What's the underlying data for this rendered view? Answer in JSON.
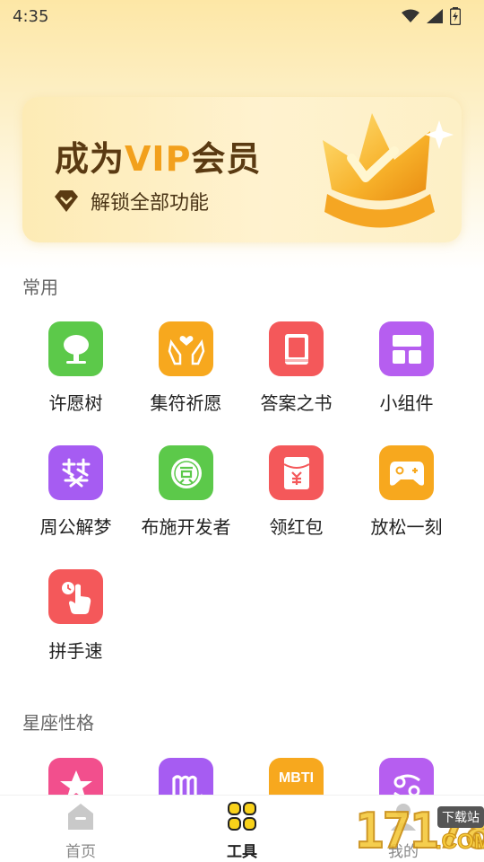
{
  "status_bar": {
    "time": "4:35"
  },
  "vip_banner": {
    "title_prefix": "成为",
    "title_highlight": "VIP",
    "title_suffix": "会员",
    "subtitle": "解锁全部功能"
  },
  "sections": {
    "common": "常用",
    "zodiac": "星座性格"
  },
  "common_tools": [
    {
      "label": "许愿树",
      "icon": "tree-icon",
      "color": "#5cc94a"
    },
    {
      "label": "集符祈愿",
      "icon": "praying-hands-icon",
      "color": "#f7a81e"
    },
    {
      "label": "答案之书",
      "icon": "book-icon",
      "color": "#f4585a"
    },
    {
      "label": "小组件",
      "icon": "widget-grid-icon",
      "color": "#b65ef0"
    },
    {
      "label": "周公解梦",
      "icon": "dream-icon",
      "color": "#a65cf2"
    },
    {
      "label": "布施开发者",
      "icon": "reward-icon",
      "color": "#5cc94a"
    },
    {
      "label": "领红包",
      "icon": "red-packet-icon",
      "color": "#f4585a"
    },
    {
      "label": "放松一刻",
      "icon": "gamepad-icon",
      "color": "#f7a81e"
    },
    {
      "label": "拼手速",
      "icon": "tap-hand-icon",
      "color": "#f4585a"
    }
  ],
  "zodiac_tools": [
    {
      "label": "",
      "icon": "star-icon",
      "color": "#f24f8d"
    },
    {
      "label": "",
      "icon": "virgo-icon",
      "color": "#a65cf2"
    },
    {
      "label": "MBTI",
      "icon": "mbti-icon",
      "color": "#f7a81e"
    },
    {
      "label": "",
      "icon": "cancer-icon",
      "color": "#b65ef0"
    }
  ],
  "bottom_nav": [
    {
      "label": "首页",
      "icon": "home-icon",
      "active": false
    },
    {
      "label": "工具",
      "icon": "tools-grid-icon",
      "active": true
    },
    {
      "label": "我的",
      "icon": "profile-icon",
      "active": false
    }
  ],
  "watermark": {
    "text": "17178",
    "badge": "下载站",
    "suffix": ".COM"
  },
  "colors": {
    "accent": "#f2a01c",
    "vip_dark": "#5a3a12",
    "nav_active": "#222222",
    "nav_inactive": "#888888"
  }
}
